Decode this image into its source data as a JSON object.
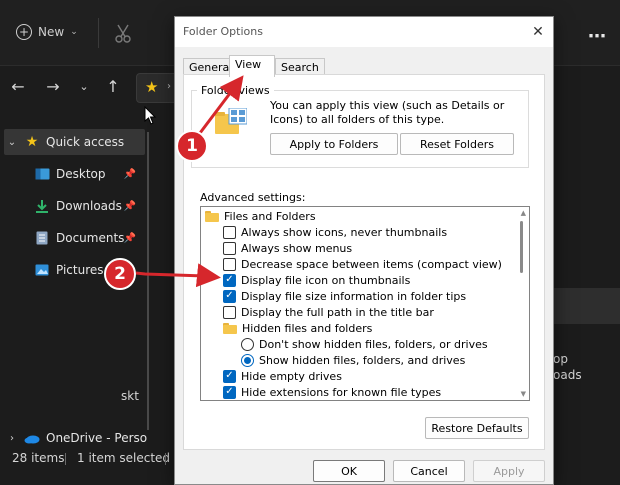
{
  "explorer": {
    "toolbar": {
      "new_label": "New"
    },
    "sidebar": {
      "quick_access": "Quick access",
      "items": [
        {
          "label": "Desktop",
          "icon": "desktop-icon"
        },
        {
          "label": "Downloads",
          "icon": "downloads-icon"
        },
        {
          "label": "Documents",
          "icon": "documents-icon"
        },
        {
          "label": "Pictures",
          "icon": "pictures-icon"
        }
      ],
      "partial_label": "skt",
      "onedrive": "OneDrive - Perso"
    },
    "main": {
      "partial_line1": "op",
      "partial_line2": "oads"
    },
    "status": {
      "items_count": "28 items",
      "selected": "1 item selected"
    }
  },
  "dialog": {
    "title": "Folder Options",
    "tabs": [
      "General",
      "View",
      "Search"
    ],
    "active_tab": "View",
    "folder_views": {
      "legend": "Folder views",
      "description": "You can apply this view (such as Details or Icons) to all folders of this type.",
      "apply_button": "Apply to Folders",
      "reset_button": "Reset Folders"
    },
    "advanced": {
      "label": "Advanced settings:",
      "items": [
        {
          "type": "folder",
          "label": "Files and Folders",
          "indent": 0
        },
        {
          "type": "checkbox",
          "label": "Always show icons, never thumbnails",
          "checked": false,
          "indent": 1
        },
        {
          "type": "checkbox",
          "label": "Always show menus",
          "checked": false,
          "indent": 1
        },
        {
          "type": "checkbox",
          "label": "Decrease space between items (compact view)",
          "checked": false,
          "indent": 1
        },
        {
          "type": "checkbox",
          "label": "Display file icon on thumbnails",
          "checked": true,
          "indent": 1
        },
        {
          "type": "checkbox",
          "label": "Display file size information in folder tips",
          "checked": true,
          "indent": 1
        },
        {
          "type": "checkbox",
          "label": "Display the full path in the title bar",
          "checked": false,
          "indent": 1
        },
        {
          "type": "folder",
          "label": "Hidden files and folders",
          "indent": 1
        },
        {
          "type": "radio",
          "label": "Don't show hidden files, folders, or drives",
          "checked": false,
          "indent": 2
        },
        {
          "type": "radio",
          "label": "Show hidden files, folders, and drives",
          "checked": true,
          "indent": 2
        },
        {
          "type": "checkbox",
          "label": "Hide empty drives",
          "checked": true,
          "indent": 1
        },
        {
          "type": "checkbox",
          "label": "Hide extensions for known file types",
          "checked": true,
          "indent": 1
        }
      ],
      "restore_button": "Restore Defaults"
    },
    "buttons": {
      "ok": "OK",
      "cancel": "Cancel",
      "apply": "Apply"
    }
  },
  "annotations": {
    "marker_1": "1",
    "marker_2": "2"
  },
  "colors": {
    "accent": "#0067c0",
    "marker": "#d6272c",
    "explorer_bg": "#1c1c1c"
  }
}
